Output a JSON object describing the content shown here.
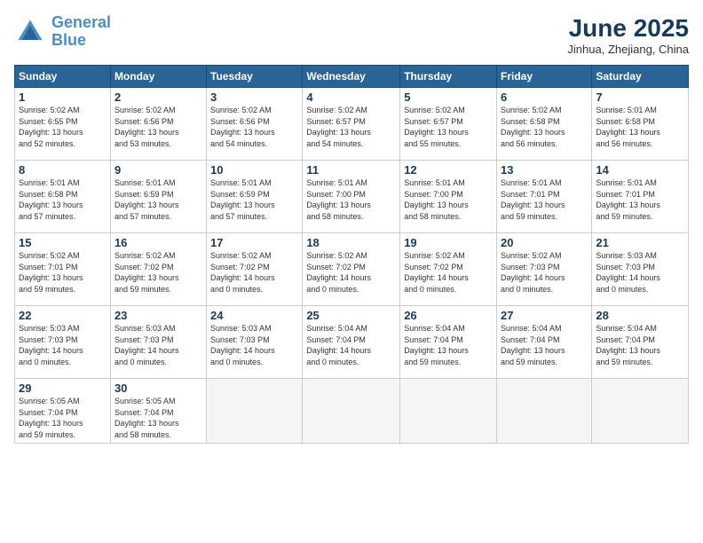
{
  "header": {
    "logo_line1": "General",
    "logo_line2": "Blue",
    "month_title": "June 2025",
    "location": "Jinhua, Zhejiang, China"
  },
  "weekdays": [
    "Sunday",
    "Monday",
    "Tuesday",
    "Wednesday",
    "Thursday",
    "Friday",
    "Saturday"
  ],
  "days": [
    {
      "num": "1",
      "sunrise": "5:02 AM",
      "sunset": "6:55 PM",
      "daylight": "13 hours and 52 minutes."
    },
    {
      "num": "2",
      "sunrise": "5:02 AM",
      "sunset": "6:56 PM",
      "daylight": "13 hours and 53 minutes."
    },
    {
      "num": "3",
      "sunrise": "5:02 AM",
      "sunset": "6:56 PM",
      "daylight": "13 hours and 54 minutes."
    },
    {
      "num": "4",
      "sunrise": "5:02 AM",
      "sunset": "6:57 PM",
      "daylight": "13 hours and 54 minutes."
    },
    {
      "num": "5",
      "sunrise": "5:02 AM",
      "sunset": "6:57 PM",
      "daylight": "13 hours and 55 minutes."
    },
    {
      "num": "6",
      "sunrise": "5:02 AM",
      "sunset": "6:58 PM",
      "daylight": "13 hours and 56 minutes."
    },
    {
      "num": "7",
      "sunrise": "5:01 AM",
      "sunset": "6:58 PM",
      "daylight": "13 hours and 56 minutes."
    },
    {
      "num": "8",
      "sunrise": "5:01 AM",
      "sunset": "6:58 PM",
      "daylight": "13 hours and 57 minutes."
    },
    {
      "num": "9",
      "sunrise": "5:01 AM",
      "sunset": "6:59 PM",
      "daylight": "13 hours and 57 minutes."
    },
    {
      "num": "10",
      "sunrise": "5:01 AM",
      "sunset": "6:59 PM",
      "daylight": "13 hours and 57 minutes."
    },
    {
      "num": "11",
      "sunrise": "5:01 AM",
      "sunset": "7:00 PM",
      "daylight": "13 hours and 58 minutes."
    },
    {
      "num": "12",
      "sunrise": "5:01 AM",
      "sunset": "7:00 PM",
      "daylight": "13 hours and 58 minutes."
    },
    {
      "num": "13",
      "sunrise": "5:01 AM",
      "sunset": "7:01 PM",
      "daylight": "13 hours and 59 minutes."
    },
    {
      "num": "14",
      "sunrise": "5:01 AM",
      "sunset": "7:01 PM",
      "daylight": "13 hours and 59 minutes."
    },
    {
      "num": "15",
      "sunrise": "5:02 AM",
      "sunset": "7:01 PM",
      "daylight": "13 hours and 59 minutes."
    },
    {
      "num": "16",
      "sunrise": "5:02 AM",
      "sunset": "7:02 PM",
      "daylight": "13 hours and 59 minutes."
    },
    {
      "num": "17",
      "sunrise": "5:02 AM",
      "sunset": "7:02 PM",
      "daylight": "14 hours and 0 minutes."
    },
    {
      "num": "18",
      "sunrise": "5:02 AM",
      "sunset": "7:02 PM",
      "daylight": "14 hours and 0 minutes."
    },
    {
      "num": "19",
      "sunrise": "5:02 AM",
      "sunset": "7:02 PM",
      "daylight": "14 hours and 0 minutes."
    },
    {
      "num": "20",
      "sunrise": "5:02 AM",
      "sunset": "7:03 PM",
      "daylight": "14 hours and 0 minutes."
    },
    {
      "num": "21",
      "sunrise": "5:03 AM",
      "sunset": "7:03 PM",
      "daylight": "14 hours and 0 minutes."
    },
    {
      "num": "22",
      "sunrise": "5:03 AM",
      "sunset": "7:03 PM",
      "daylight": "14 hours and 0 minutes."
    },
    {
      "num": "23",
      "sunrise": "5:03 AM",
      "sunset": "7:03 PM",
      "daylight": "14 hours and 0 minutes."
    },
    {
      "num": "24",
      "sunrise": "5:03 AM",
      "sunset": "7:03 PM",
      "daylight": "14 hours and 0 minutes."
    },
    {
      "num": "25",
      "sunrise": "5:04 AM",
      "sunset": "7:04 PM",
      "daylight": "14 hours and 0 minutes."
    },
    {
      "num": "26",
      "sunrise": "5:04 AM",
      "sunset": "7:04 PM",
      "daylight": "13 hours and 59 minutes."
    },
    {
      "num": "27",
      "sunrise": "5:04 AM",
      "sunset": "7:04 PM",
      "daylight": "13 hours and 59 minutes."
    },
    {
      "num": "28",
      "sunrise": "5:04 AM",
      "sunset": "7:04 PM",
      "daylight": "13 hours and 59 minutes."
    },
    {
      "num": "29",
      "sunrise": "5:05 AM",
      "sunset": "7:04 PM",
      "daylight": "13 hours and 59 minutes."
    },
    {
      "num": "30",
      "sunrise": "5:05 AM",
      "sunset": "7:04 PM",
      "daylight": "13 hours and 58 minutes."
    }
  ]
}
